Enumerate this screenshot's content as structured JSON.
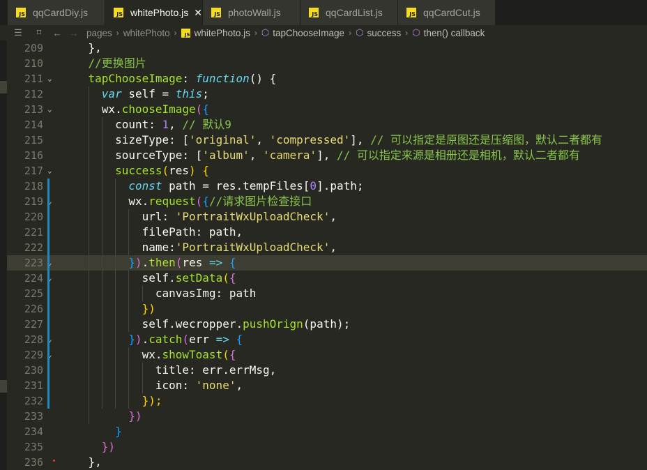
{
  "tabs": [
    {
      "label": "qqCardDiy.js",
      "active": false
    },
    {
      "label": "whitePhoto.js",
      "active": true
    },
    {
      "label": "photoWall.js",
      "active": false
    },
    {
      "label": "qqCardList.js",
      "active": false
    },
    {
      "label": "qqCardCut.js",
      "active": false
    }
  ],
  "tab_icon_text": "JS",
  "close_glyph": "✕",
  "breadcrumb": {
    "items": [
      "pages",
      "whitePhoto",
      "whitePhoto.js",
      "tapChooseImage",
      "success",
      "then() callback"
    ]
  },
  "code": {
    "line_numbers": [
      "209",
      "210",
      "211",
      "212",
      "213",
      "214",
      "215",
      "216",
      "217",
      "218",
      "219",
      "220",
      "221",
      "222",
      "223",
      "224",
      "225",
      "226",
      "227",
      "228",
      "229",
      "230",
      "231",
      "232",
      "233",
      "234",
      "235",
      "236"
    ],
    "lines": [
      [
        [
          "p",
          "    },"
        ]
      ],
      [
        [
          "c",
          "    //更换图片"
        ]
      ],
      [
        [
          "f",
          "    tapChooseImage"
        ],
        [
          "p",
          ": "
        ],
        [
          "k",
          "function"
        ],
        [
          "p",
          "() {"
        ]
      ],
      [
        [
          "k",
          "      var"
        ],
        [
          "p",
          " self = "
        ],
        [
          "k",
          "this"
        ],
        [
          "p",
          ";"
        ]
      ],
      [
        [
          "p",
          "      wx."
        ],
        [
          "f",
          "chooseImage"
        ],
        [
          "br2",
          "("
        ],
        [
          "br3",
          "{"
        ]
      ],
      [
        [
          "p",
          "        count: "
        ],
        [
          "n",
          "1"
        ],
        [
          "p",
          ", "
        ],
        [
          "c",
          "// 默认9"
        ]
      ],
      [
        [
          "p",
          "        sizeType: ["
        ],
        [
          "s",
          "'original'"
        ],
        [
          "p",
          ", "
        ],
        [
          "s",
          "'compressed'"
        ],
        [
          "p",
          "], "
        ],
        [
          "c",
          "// 可以指定是原图还是压缩图，默认二者都有"
        ]
      ],
      [
        [
          "p",
          "        sourceType: ["
        ],
        [
          "s",
          "'album'"
        ],
        [
          "p",
          ", "
        ],
        [
          "s",
          "'camera'"
        ],
        [
          "p",
          "], "
        ],
        [
          "c",
          "// 可以指定来源是相册还是相机，默认二者都有"
        ]
      ],
      [
        [
          "f",
          "        success"
        ],
        [
          "br1",
          "("
        ],
        [
          "p",
          "res"
        ],
        [
          "br1",
          ")"
        ],
        [
          "p",
          " "
        ],
        [
          "br1",
          "{"
        ]
      ],
      [
        [
          "k",
          "          const"
        ],
        [
          "p",
          " path = res.tempFiles["
        ],
        [
          "n",
          "0"
        ],
        [
          "p",
          "].path;"
        ]
      ],
      [
        [
          "p",
          "          wx."
        ],
        [
          "f",
          "request"
        ],
        [
          "br2",
          "("
        ],
        [
          "br3",
          "{"
        ],
        [
          "c",
          "//请求图片检查接口"
        ]
      ],
      [
        [
          "p",
          "            url: "
        ],
        [
          "s",
          "'PortraitWxUploadCheck'"
        ],
        [
          "p",
          ","
        ]
      ],
      [
        [
          "p",
          "            filePath: path,"
        ]
      ],
      [
        [
          "p",
          "            name:"
        ],
        [
          "s",
          "'PortraitWxUploadCheck'"
        ],
        [
          "p",
          ","
        ]
      ],
      [
        [
          "br3",
          "          }"
        ],
        [
          "br2",
          ")"
        ],
        [
          "p",
          "."
        ],
        [
          "f",
          "then"
        ],
        [
          "br2",
          "("
        ],
        [
          "p",
          "res "
        ],
        [
          "k",
          "=>"
        ],
        [
          "p",
          " "
        ],
        [
          "br3",
          "{"
        ]
      ],
      [
        [
          "p",
          "            self."
        ],
        [
          "f",
          "setData"
        ],
        [
          "br1",
          "("
        ],
        [
          "br2",
          "{"
        ]
      ],
      [
        [
          "p",
          "              canvasImg: path"
        ]
      ],
      [
        [
          "br1",
          "            })"
        ]
      ],
      [
        [
          "p",
          "            self.wecropper."
        ],
        [
          "f",
          "pushOrign"
        ],
        [
          "p",
          "(path);"
        ]
      ],
      [
        [
          "br3",
          "          }"
        ],
        [
          "br2",
          ")"
        ],
        [
          "p",
          "."
        ],
        [
          "f",
          "catch"
        ],
        [
          "br2",
          "("
        ],
        [
          "p",
          "err "
        ],
        [
          "k",
          "=>"
        ],
        [
          "p",
          " "
        ],
        [
          "br3",
          "{"
        ]
      ],
      [
        [
          "p",
          "            wx."
        ],
        [
          "f",
          "showToast"
        ],
        [
          "br1",
          "("
        ],
        [
          "br2",
          "{"
        ]
      ],
      [
        [
          "p",
          "              title: err.errMsg,"
        ]
      ],
      [
        [
          "p",
          "              icon: "
        ],
        [
          "s",
          "'none'"
        ],
        [
          "p",
          ","
        ]
      ],
      [
        [
          "br1",
          "            });"
        ]
      ],
      [
        [
          "br2",
          "          })"
        ]
      ],
      [
        [
          "br3",
          "        }"
        ]
      ],
      [
        [
          "br2",
          "      })"
        ]
      ],
      [
        [
          "p",
          "    },"
        ]
      ]
    ]
  }
}
